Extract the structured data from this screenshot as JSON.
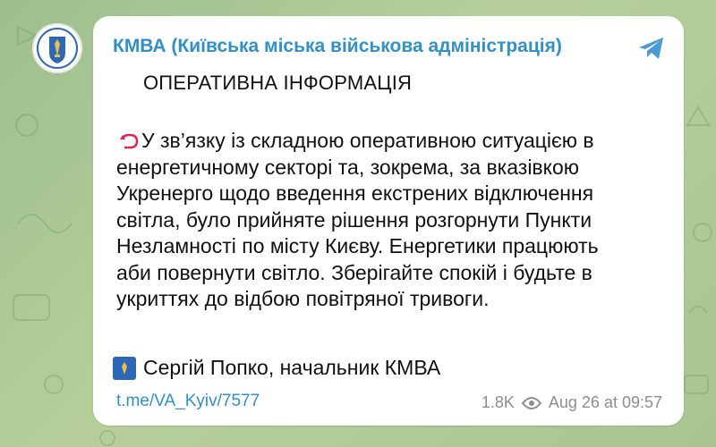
{
  "channel": {
    "name": "КМВА (Київська міська військова адміністрація)",
    "avatar_icon": "kyiv-coat-of-arms-icon",
    "share_icon": "telegram-share-icon"
  },
  "post": {
    "heading": "ОПЕРАТИВНА ІНФОРМАЦІЯ",
    "warning_icon": "red-u-turn-arrow-icon",
    "lines": [
      "У зв’язку із складною оперативною ситуацією в",
      "енергетичному секторі та, зокрема, за вказівкою",
      "Укренерго щодо введення екстрених відключення",
      "світла, було прийняте рішення розгорнути Пункти",
      "Незламності по місту Києву. Енергетики працюють",
      "аби повернути світло. Зберігайте спокій і будьте в",
      "укриттях до відбою повітряної тривоги."
    ],
    "signature": "Сергій Попко, начальник КМВА",
    "signature_icon": "kyiv-emblem-icon",
    "link": "t.me/VA_Kyiv/7577",
    "views": "1.8K",
    "views_icon": "eye-icon",
    "timestamp": "Aug 26 at 09:57"
  },
  "colors": {
    "accent": "#3390c4",
    "bubble": "#ffffff",
    "background": "#a9c690",
    "warning": "#e0244a"
  }
}
